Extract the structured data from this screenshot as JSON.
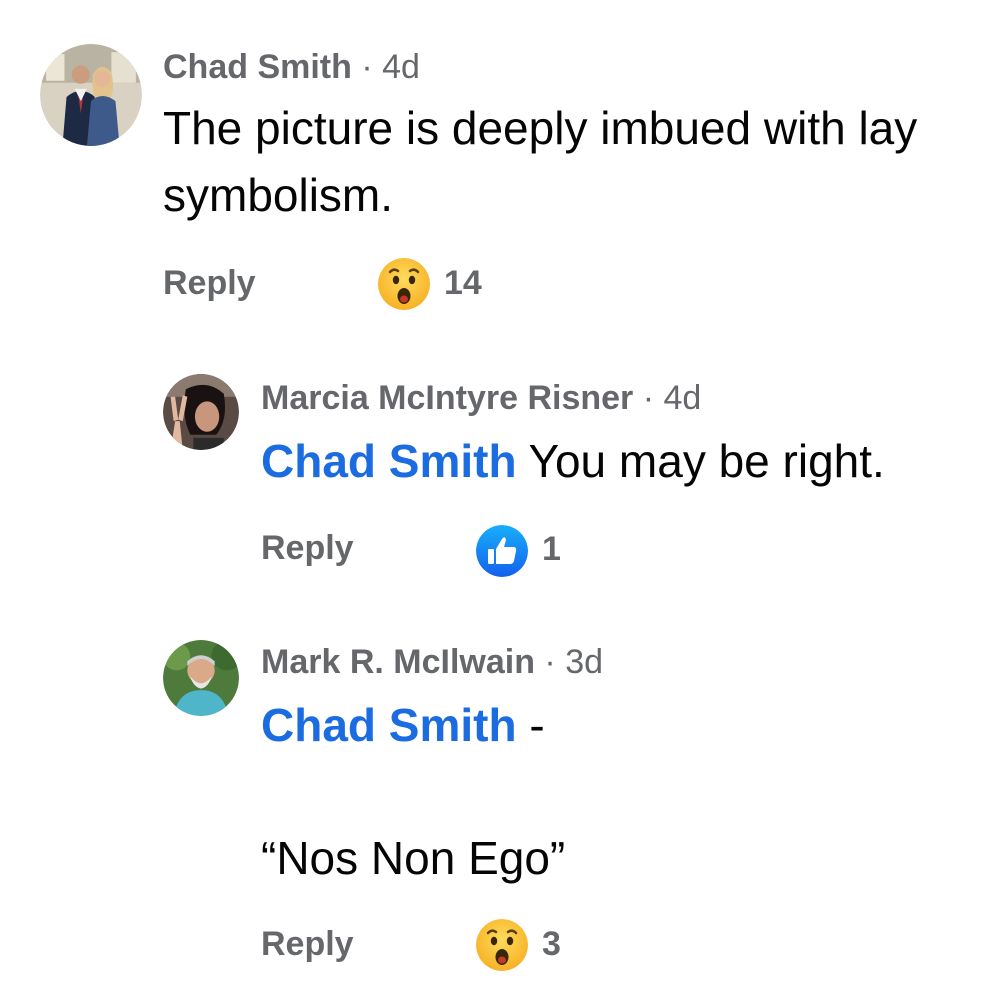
{
  "comments": [
    {
      "author": "Chad Smith",
      "time": "4d",
      "text_line1": "The picture is deeply imbued with lay",
      "text_line2": "symbolism.",
      "reply_label": "Reply",
      "reaction": "wow-icon",
      "reaction_count": "14"
    },
    {
      "author": "Marcia McIntyre Risner",
      "time": "4d",
      "mention": "Chad Smith",
      "text": "You may be right.",
      "reply_label": "Reply",
      "reaction": "like-icon",
      "reaction_count": "1"
    },
    {
      "author": "Mark R. McIlwain",
      "time": "3d",
      "mention": "Chad Smith",
      "text_suffix": "-",
      "text_quote": "“Nos Non Ego”",
      "reply_label": "Reply",
      "reaction": "wow-icon",
      "reaction_count": "3"
    }
  ],
  "separator": "·",
  "colors": {
    "meta_gray": "#65676b",
    "body_text": "#050505",
    "mention_blue": "#1b6ce0",
    "like_blue": "#1877f2",
    "wow_yellow": "#f7b125"
  }
}
